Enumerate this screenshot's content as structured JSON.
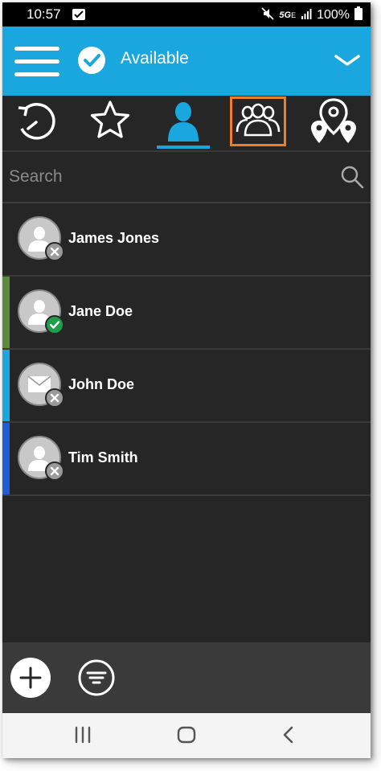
{
  "status_bar": {
    "time": "10:57",
    "network": "5G",
    "network_sub": "E",
    "battery": "100%"
  },
  "app_bar": {
    "status_label": "Available",
    "icons": [
      "menu-icon",
      "check-circle-icon",
      "chevron-down-icon"
    ]
  },
  "tabs": [
    {
      "name": "history",
      "icon": "history-icon",
      "active": false
    },
    {
      "name": "favorites",
      "icon": "star-icon",
      "active": false
    },
    {
      "name": "contacts",
      "icon": "contact-icon",
      "active": true
    },
    {
      "name": "groups",
      "icon": "group-icon",
      "active": false,
      "highlighted": true
    },
    {
      "name": "map",
      "icon": "map-pin-icon",
      "active": false
    }
  ],
  "search": {
    "placeholder": "Search"
  },
  "contacts": [
    {
      "name": "James Jones",
      "avatar": "person",
      "status": "offline",
      "bar_color": ""
    },
    {
      "name": "Jane Doe",
      "avatar": "person",
      "status": "available",
      "bar_color": "#5a8a3a"
    },
    {
      "name": "John Doe",
      "avatar": "mail",
      "status": "offline",
      "bar_color": "#1aa7e0"
    },
    {
      "name": "Tim Smith",
      "avatar": "person",
      "status": "offline",
      "bar_color": "#1d5ed6"
    }
  ],
  "colors": {
    "accent": "#1aa7e0",
    "highlight": "#ee7f27",
    "available": "#1e9e4a",
    "offline": "#9a9a9a",
    "background": "#262626"
  }
}
